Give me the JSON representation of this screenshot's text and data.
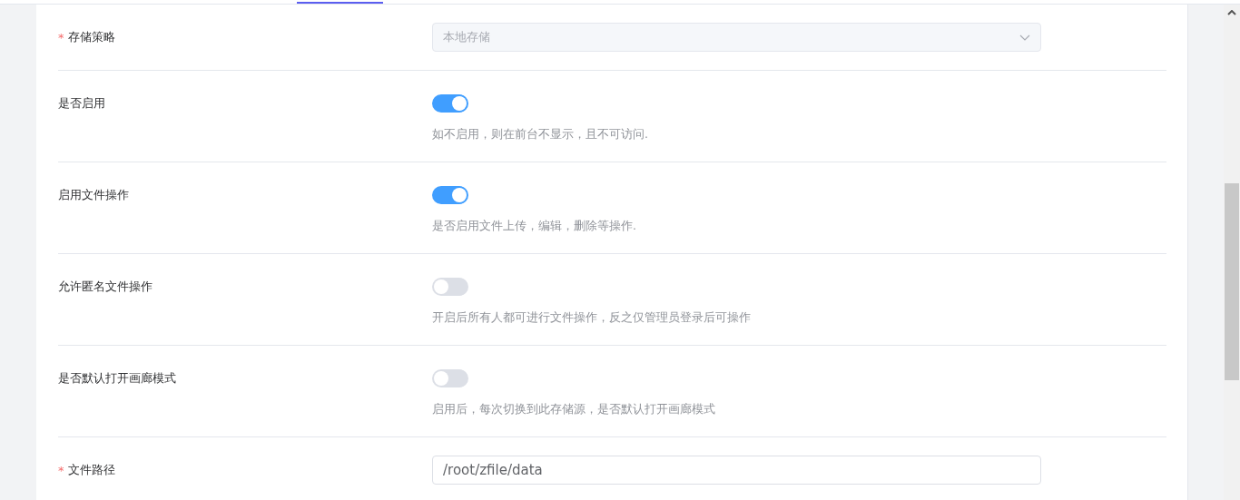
{
  "fields": [
    {
      "kind": "select",
      "label": "存储策略",
      "required_mark": "*",
      "value": "本地存储",
      "disabled": true
    },
    {
      "kind": "switch",
      "label": "是否启用",
      "on": true,
      "hint": "如不启用，则在前台不显示，且不可访问."
    },
    {
      "kind": "switch",
      "label": "启用文件操作",
      "on": true,
      "hint": "是否启用文件上传，编辑，删除等操作."
    },
    {
      "kind": "switch",
      "label": "允许匿名文件操作",
      "on": false,
      "hint": "开启后所有人都可进行文件操作，反之仅管理员登录后可操作"
    },
    {
      "kind": "switch",
      "label": "是否默认打开画廊模式",
      "on": false,
      "hint": "启用后，每次切换到此存储源，是否默认打开画廊模式"
    },
    {
      "kind": "text",
      "label": "文件路径",
      "required_mark": "*",
      "value": "/root/zfile/data"
    }
  ]
}
